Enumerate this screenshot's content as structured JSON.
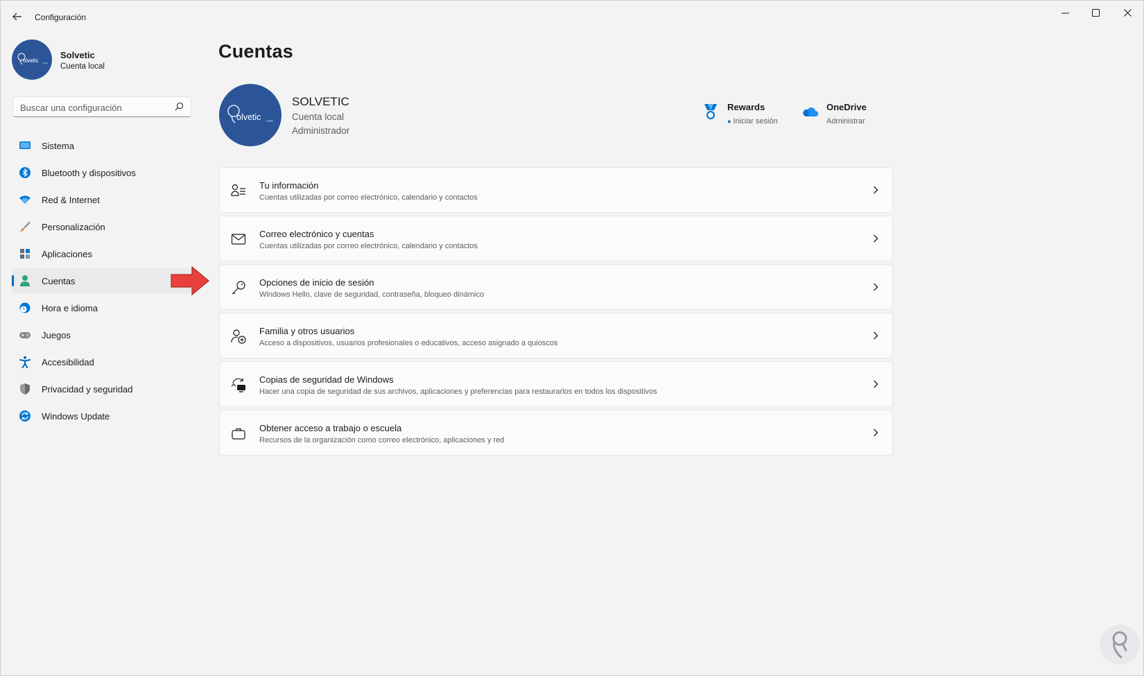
{
  "window": {
    "title": "Configuración"
  },
  "profile": {
    "name": "Solvetic",
    "type": "Cuenta local",
    "logo_text": "olvetic",
    "logo_suffix": ".com"
  },
  "search": {
    "placeholder": "Buscar una configuración"
  },
  "nav": {
    "active": "Cuentas",
    "items": [
      {
        "label": "Sistema",
        "icon": "monitor-icon",
        "color": "#0078d4"
      },
      {
        "label": "Bluetooth y dispositivos",
        "icon": "bluetooth-icon",
        "color": "#0078d4"
      },
      {
        "label": "Red & Internet",
        "icon": "wifi-icon",
        "color": "#0078d4"
      },
      {
        "label": "Personalización",
        "icon": "brush-icon",
        "color": "#d97b3a"
      },
      {
        "label": "Aplicaciones",
        "icon": "apps-icon",
        "color": "#5d6b7a"
      },
      {
        "label": "Cuentas",
        "icon": "person-icon",
        "color": "#2fa37a"
      },
      {
        "label": "Hora e idioma",
        "icon": "globe-clock-icon",
        "color": "#0078d4"
      },
      {
        "label": "Juegos",
        "icon": "gamepad-icon",
        "color": "#7a7a7a"
      },
      {
        "label": "Accesibilidad",
        "icon": "accessibility-icon",
        "color": "#0067c0"
      },
      {
        "label": "Privacidad y seguridad",
        "icon": "shield-icon",
        "color": "#6b6b6b"
      },
      {
        "label": "Windows Update",
        "icon": "update-icon",
        "color": "#0078d4"
      }
    ]
  },
  "main": {
    "title": "Cuentas",
    "account": {
      "name": "SOLVETIC",
      "type": "Cuenta local",
      "role": "Administrador"
    },
    "services": [
      {
        "name": "Rewards",
        "sub": "Iniciar sesión",
        "icon": "rewards-medal-icon"
      },
      {
        "name": "OneDrive",
        "sub": "Administrar",
        "icon": "onedrive-cloud-icon"
      }
    ],
    "cards": [
      {
        "title": "Tu información",
        "sub": "Cuentas utilizadas por correo electrónico, calendario y contactos",
        "icon": "person-info-icon"
      },
      {
        "title": "Correo electrónico y cuentas",
        "sub": "Cuentas utilizadas por correo electrónico, calendario y contactos",
        "icon": "mail-icon"
      },
      {
        "title": "Opciones de inicio de sesión",
        "sub": "Windows Hello, clave de seguridad, contraseña, bloqueo dinámico",
        "icon": "key-icon"
      },
      {
        "title": "Familia y otros usuarios",
        "sub": "Acceso a dispositivos, usuarios profesionales o educativos, acceso asignado a quioscos",
        "icon": "person-add-icon"
      },
      {
        "title": "Copias de seguridad de Windows",
        "sub": "Hacer una copia de seguridad de sus archivos, aplicaciones y preferencias para restaurarlos en todos los dispositivos",
        "icon": "backup-sync-icon"
      },
      {
        "title": "Obtener acceso a trabajo o escuela",
        "sub": "Recursos de la organización como correo electrónico, aplicaciones y red",
        "icon": "briefcase-icon"
      }
    ]
  },
  "annotation": {
    "arrow_color": "#e8413c"
  }
}
